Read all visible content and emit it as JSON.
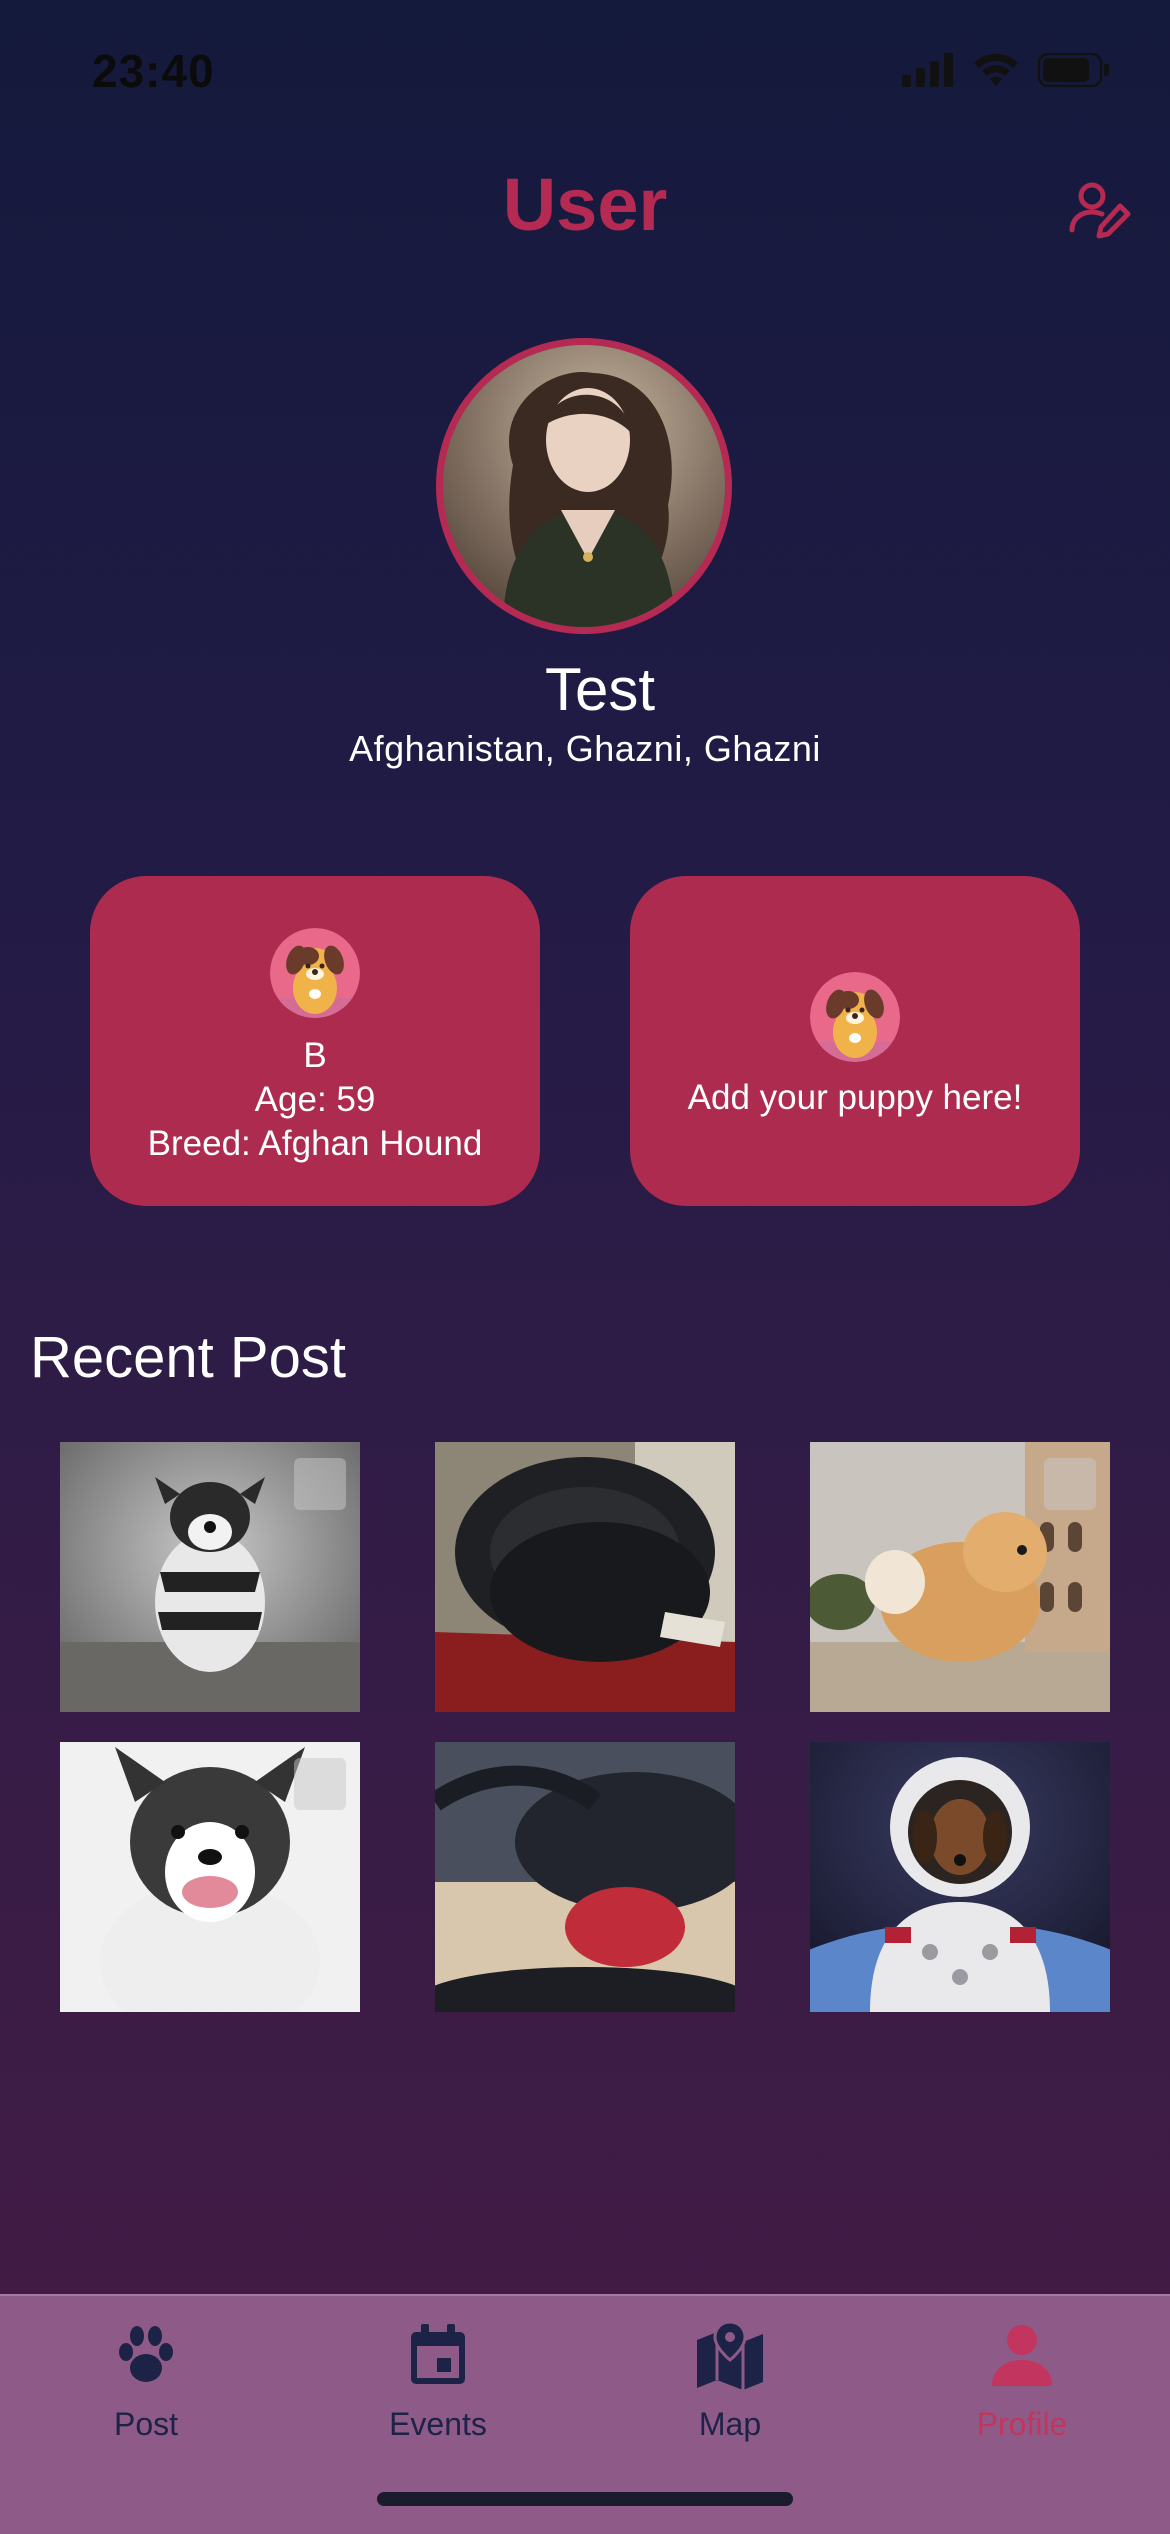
{
  "status_bar": {
    "time": "23:40"
  },
  "header": {
    "title": "User"
  },
  "profile": {
    "name": "Test",
    "location": "Afghanistan, Ghazni, Ghazni"
  },
  "pets": [
    {
      "name": "B",
      "age": "Age: 59",
      "breed": "Breed: Afghan Hound"
    }
  ],
  "add_pet": {
    "label": "Add your puppy here!"
  },
  "recent": {
    "title": "Recent Post",
    "posts": [
      {
        "image": "bulldog-in-striped-outfit-running",
        "multi": true
      },
      {
        "image": "black-headphones-on-red-item",
        "multi": false
      },
      {
        "image": "pomeranian-at-colosseum",
        "multi": true
      },
      {
        "image": "border-collie-smiling",
        "multi": true
      },
      {
        "image": "headphones-close-up",
        "multi": false
      },
      {
        "image": "dachshund-astronaut",
        "multi": false
      }
    ]
  },
  "nav": [
    {
      "label": "Post",
      "icon": "paw-icon",
      "active": false
    },
    {
      "label": "Events",
      "icon": "calendar-icon",
      "active": false
    },
    {
      "label": "Map",
      "icon": "map-icon",
      "active": false
    },
    {
      "label": "Profile",
      "icon": "person-icon",
      "active": true
    }
  ],
  "colors": {
    "accent": "#b52a52",
    "card": "#ad2b4f",
    "nav_bg": "#8e5a88",
    "nav_icon": "#1c2347"
  }
}
